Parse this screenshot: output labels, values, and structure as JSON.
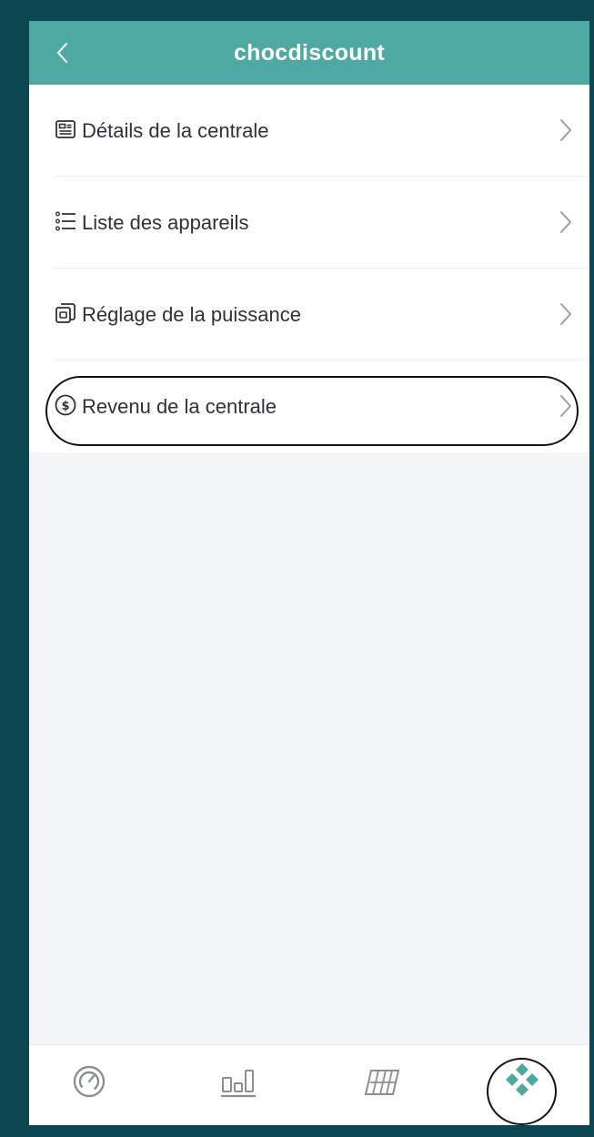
{
  "header": {
    "title": "chocdiscount"
  },
  "menu": {
    "items": [
      {
        "label": "Détails de la centrale",
        "icon": "document-card-icon"
      },
      {
        "label": "Liste des appareils",
        "icon": "list-icon"
      },
      {
        "label": "Réglage de la puissance",
        "icon": "power-setting-icon"
      },
      {
        "label": "Revenu de la centrale",
        "icon": "dollar-circle-icon"
      }
    ]
  },
  "tabbar": {
    "tabs": [
      {
        "icon": "gauge-icon",
        "active": false
      },
      {
        "icon": "bar-chart-icon",
        "active": false
      },
      {
        "icon": "solar-panel-icon",
        "active": false
      },
      {
        "icon": "diamond-grid-icon",
        "active": true
      }
    ]
  },
  "colors": {
    "header_bg": "#4fa9a3",
    "accent": "#4fa9a3",
    "text": "#2c313a",
    "icon_gray": "#8a8f96",
    "background": "#f4f5f8",
    "frame": "#0b4651"
  }
}
